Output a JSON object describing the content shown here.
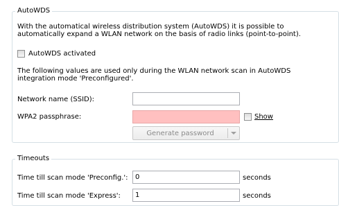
{
  "autowds": {
    "legend": "AutoWDS",
    "description": "With the automatical wireless distribution system (AutoWDS) it is possible to automatically expand a WLAN network on the basis of radio links (point-to-point).",
    "activated_label": "AutoWDS activated",
    "activated_checked": false,
    "note": "The following values are used only during the WLAN network scan in AutoWDS integration mode 'Preconfigured'.",
    "ssid_label": "Network name (SSID):",
    "ssid_value": "",
    "passphrase_label": "WPA2 passphrase:",
    "passphrase_value": "",
    "show_label": "Show",
    "show_checked": false,
    "generate_label": "Generate password"
  },
  "timeouts": {
    "legend": "Timeouts",
    "preconfig_label": "Time till scan mode 'Preconfig.':",
    "preconfig_value": "0",
    "preconfig_unit": "seconds",
    "express_label": "Time till scan mode 'Express':",
    "express_value": "1",
    "express_unit": "seconds"
  },
  "colors": {
    "group_border": "#d5dfe5",
    "invalid_field_bg": "#ffc0c0"
  }
}
